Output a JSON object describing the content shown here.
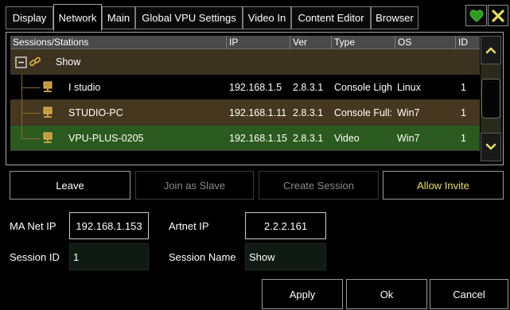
{
  "tabs": [
    {
      "label": "Display",
      "active": false
    },
    {
      "label": "Network",
      "active": true
    },
    {
      "label": "Main",
      "active": false
    },
    {
      "label": "Global VPU Settings",
      "active": false
    },
    {
      "label": "Video In",
      "active": false
    },
    {
      "label": "Content Editor",
      "active": false
    },
    {
      "label": "Browser",
      "active": false
    }
  ],
  "colors": {
    "accent_green": "#2e9b1c",
    "close_yellow": "#e5dc5a",
    "invite_text": "#e7e065",
    "row_selected_green": "#2b5a1e",
    "row_amber": "#46381f"
  },
  "icons": {
    "status": "heart-icon",
    "close": "close-icon",
    "tree_collapse": "minus-box-icon",
    "session": "chain-link-icon",
    "station": "monitor-icon",
    "scroll_up": "chevron-up-icon",
    "scroll_down": "chevron-down-icon"
  },
  "table": {
    "columns": [
      "Sessions/Stations",
      "IP",
      "Ver",
      "Type",
      "OS",
      "ID"
    ],
    "session": {
      "name": "Show"
    },
    "rows": [
      {
        "name": "I studio",
        "ip": "192.168.1.5",
        "ver": "2.8.3.1",
        "type": "Console Ligh",
        "os": "Linux",
        "id": "1"
      },
      {
        "name": "STUDIO-PC",
        "ip": "192.168.1.11",
        "ver": "2.8.3.1",
        "type": "Console Full:",
        "os": "Win7",
        "id": "1"
      },
      {
        "name": "VPU-PLUS-0205",
        "ip": "192.168.1.15",
        "ver": "2.8.3.1",
        "type": "Video",
        "os": "Win7",
        "id": "1"
      }
    ]
  },
  "actions": {
    "leave": "Leave",
    "join": "Join as Slave",
    "create": "Create Session",
    "invite": "Allow Invite"
  },
  "form": {
    "ma_net_ip_label": "MA Net IP",
    "ma_net_ip": "192.168.1.153",
    "artnet_ip_label": "Artnet IP",
    "artnet_ip": "2.2.2.161",
    "session_id_label": "Session ID",
    "session_id": "1",
    "session_name_label": "Session Name",
    "session_name": "Show"
  },
  "footer": {
    "apply": "Apply",
    "ok": "Ok",
    "cancel": "Cancel"
  }
}
